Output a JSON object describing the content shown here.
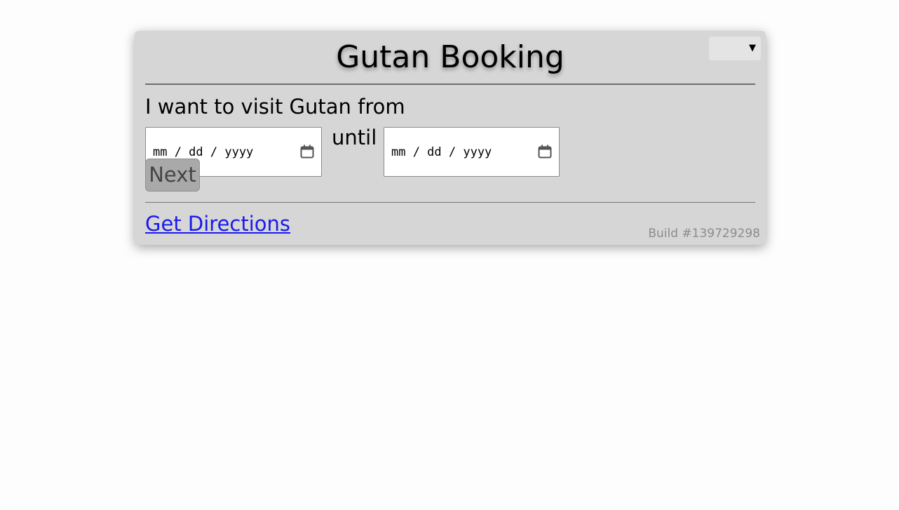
{
  "header": {
    "title": "Gutan Booking",
    "language_select": {
      "value": "",
      "arrow": "▼"
    }
  },
  "form": {
    "prompt": "I want to visit Gutan from",
    "from_date": {
      "placeholder": "mm / dd / yyyy",
      "icon": "calendar-icon"
    },
    "until_label": "until",
    "to_date": {
      "placeholder": "mm / dd / yyyy",
      "icon": "calendar-icon"
    },
    "next_label": "Next"
  },
  "footer": {
    "directions_link": "Get Directions",
    "build": "Build #139729298"
  },
  "colors": {
    "card_background": "#d6d6d6",
    "link": "#1a1aee",
    "button_disabled": "#a9a9a9",
    "build_text": "#8c8c8c"
  }
}
